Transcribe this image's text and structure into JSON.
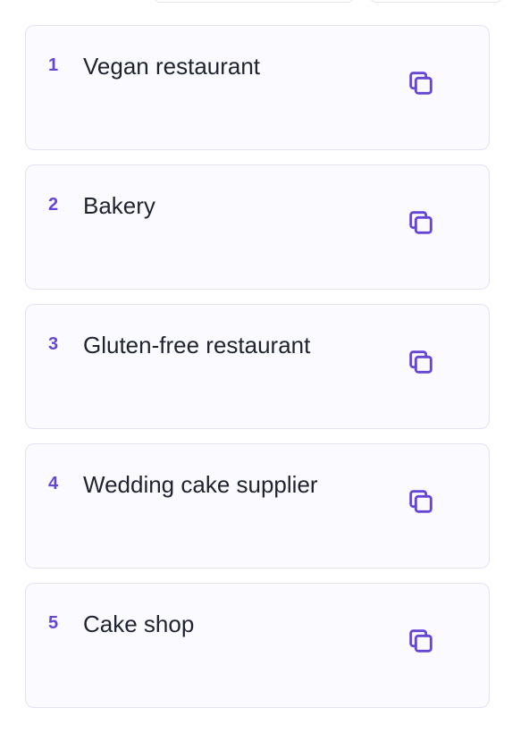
{
  "suggestions": {
    "items": [
      {
        "number": "1",
        "text": "Vegan restaurant"
      },
      {
        "number": "2",
        "text": "Bakery"
      },
      {
        "number": "3",
        "text": "Gluten-free restaurant"
      },
      {
        "number": "4",
        "text": "Wedding cake supplier"
      },
      {
        "number": "5",
        "text": "Cake shop"
      }
    ],
    "copy_icon": "copy-icon"
  },
  "colors": {
    "accent": "#6545d6",
    "card_background": "#fafaff",
    "card_border": "#e4e2f3",
    "text": "#1f2330"
  }
}
